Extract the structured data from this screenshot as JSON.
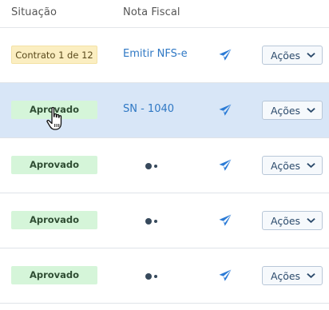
{
  "header": {
    "col_situacao": "Situação",
    "col_nota_fiscal": "Nota Fiscal"
  },
  "rows": [
    {
      "status": "Contrato 1 de 12",
      "status_kind": "contract",
      "nota_fiscal": "Emitir NFS-e",
      "nota_kind": "link",
      "actions_label": "Ações",
      "selected": false
    },
    {
      "status": "Aprovado",
      "status_kind": "approved",
      "nota_fiscal": "SN - 1040",
      "nota_kind": "link",
      "actions_label": "Ações",
      "selected": true
    },
    {
      "status": "Aprovado",
      "status_kind": "approved",
      "nota_fiscal": "",
      "nota_kind": "pending",
      "actions_label": "Ações",
      "selected": false
    },
    {
      "status": "Aprovado",
      "status_kind": "approved",
      "nota_fiscal": "",
      "nota_kind": "pending",
      "actions_label": "Ações",
      "selected": false
    },
    {
      "status": "Aprovado",
      "status_kind": "approved",
      "nota_fiscal": "",
      "nota_kind": "pending",
      "actions_label": "Ações",
      "selected": false
    }
  ],
  "icons": {
    "send": "paper-plane-icon",
    "chevron": "chevron-down-icon",
    "pending": "dots-icon",
    "cursor": "hand-pointer-cursor"
  },
  "colors": {
    "link": "#2f78c4",
    "send_icon": "#2b7bd6",
    "contract_badge": "#fbeec1",
    "approved_badge": "#d5f5d9",
    "selected_row": "#d8e6f7"
  }
}
